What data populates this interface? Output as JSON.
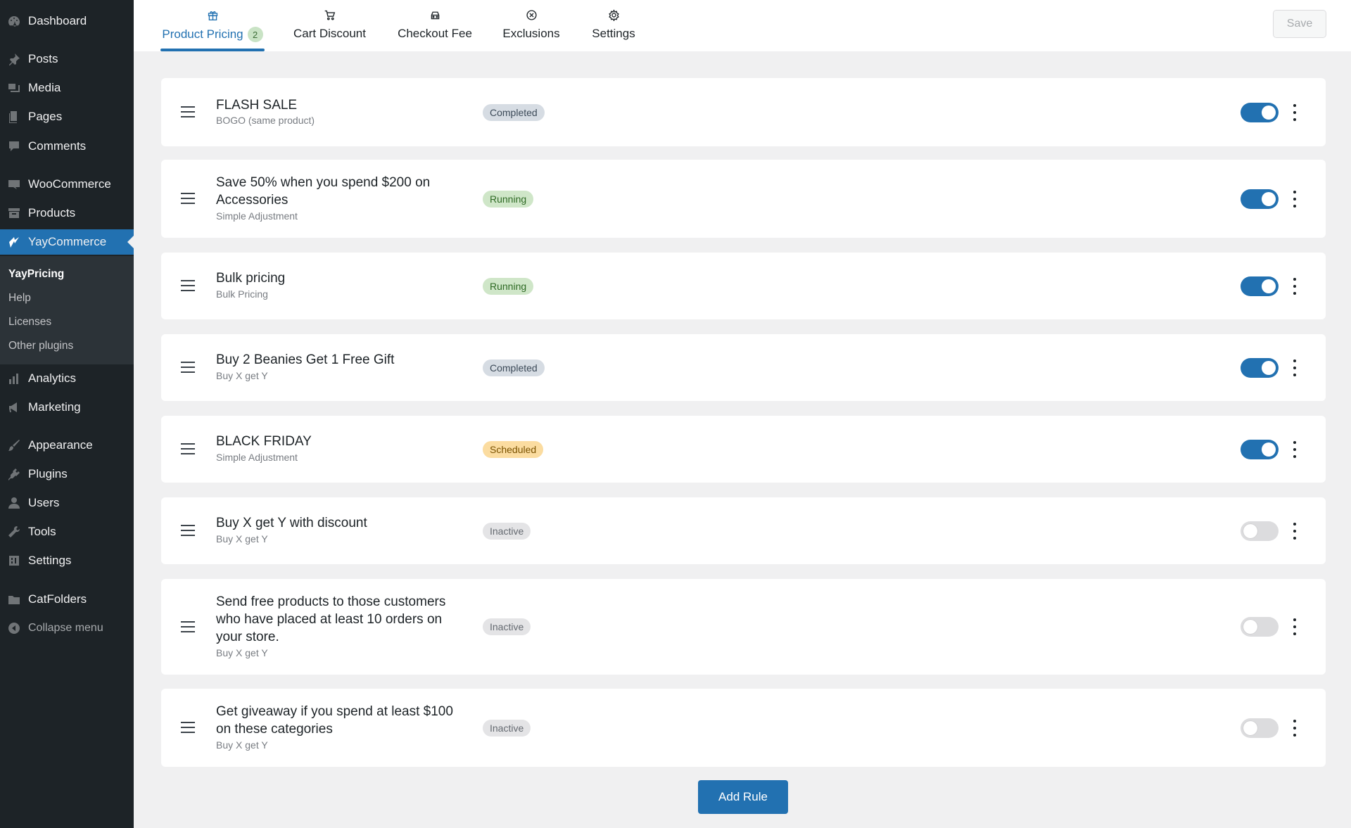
{
  "sidebar": {
    "dashboard": "Dashboard",
    "posts": "Posts",
    "media": "Media",
    "pages": "Pages",
    "comments": "Comments",
    "woocommerce": "WooCommerce",
    "products": "Products",
    "yaycommerce": "YayCommerce",
    "submenu": {
      "yaypricing": "YayPricing",
      "help": "Help",
      "licenses": "Licenses",
      "other_plugins": "Other plugins"
    },
    "analytics": "Analytics",
    "marketing": "Marketing",
    "appearance": "Appearance",
    "plugins": "Plugins",
    "users": "Users",
    "tools": "Tools",
    "settings": "Settings",
    "catfolders": "CatFolders",
    "collapse": "Collapse menu"
  },
  "tabs": [
    {
      "label": "Product Pricing",
      "icon": "gift-icon",
      "badge": "2"
    },
    {
      "label": "Cart Discount",
      "icon": "cart-icon"
    },
    {
      "label": "Checkout Fee",
      "icon": "car-icon"
    },
    {
      "label": "Exclusions",
      "icon": "x-circle-icon"
    },
    {
      "label": "Settings",
      "icon": "gear-icon"
    }
  ],
  "save_label": "Save",
  "rules": [
    {
      "title": "FLASH SALE",
      "type": "BOGO (same product)",
      "status": "Completed",
      "enabled": true
    },
    {
      "title": "Save 50% when you spend $200 on Accessories",
      "type": "Simple Adjustment",
      "status": "Running",
      "enabled": true
    },
    {
      "title": "Bulk pricing",
      "type": "Bulk Pricing",
      "status": "Running",
      "enabled": true
    },
    {
      "title": "Buy 2 Beanies Get 1 Free Gift",
      "type": "Buy X get Y",
      "status": "Completed",
      "enabled": true
    },
    {
      "title": "BLACK FRIDAY",
      "type": "Simple Adjustment",
      "status": "Scheduled",
      "enabled": true
    },
    {
      "title": "Buy X get Y with discount",
      "type": "Buy X get Y",
      "status": "Inactive",
      "enabled": false
    },
    {
      "title": "Send free products to those customers who have placed at least 10 orders on your store.",
      "type": "Buy X get Y",
      "status": "Inactive",
      "enabled": false
    },
    {
      "title": "Get giveaway if you spend at least $100 on these categories",
      "type": "Buy X get Y",
      "status": "Inactive",
      "enabled": false
    }
  ],
  "add_rule_label": "Add Rule",
  "colors": {
    "accent": "#2271b1",
    "sidebar_bg": "#1d2327",
    "completed": "#d6dce3",
    "running": "#cfe6c8",
    "scheduled": "#fbdca0",
    "inactive": "#e4e4e6"
  }
}
